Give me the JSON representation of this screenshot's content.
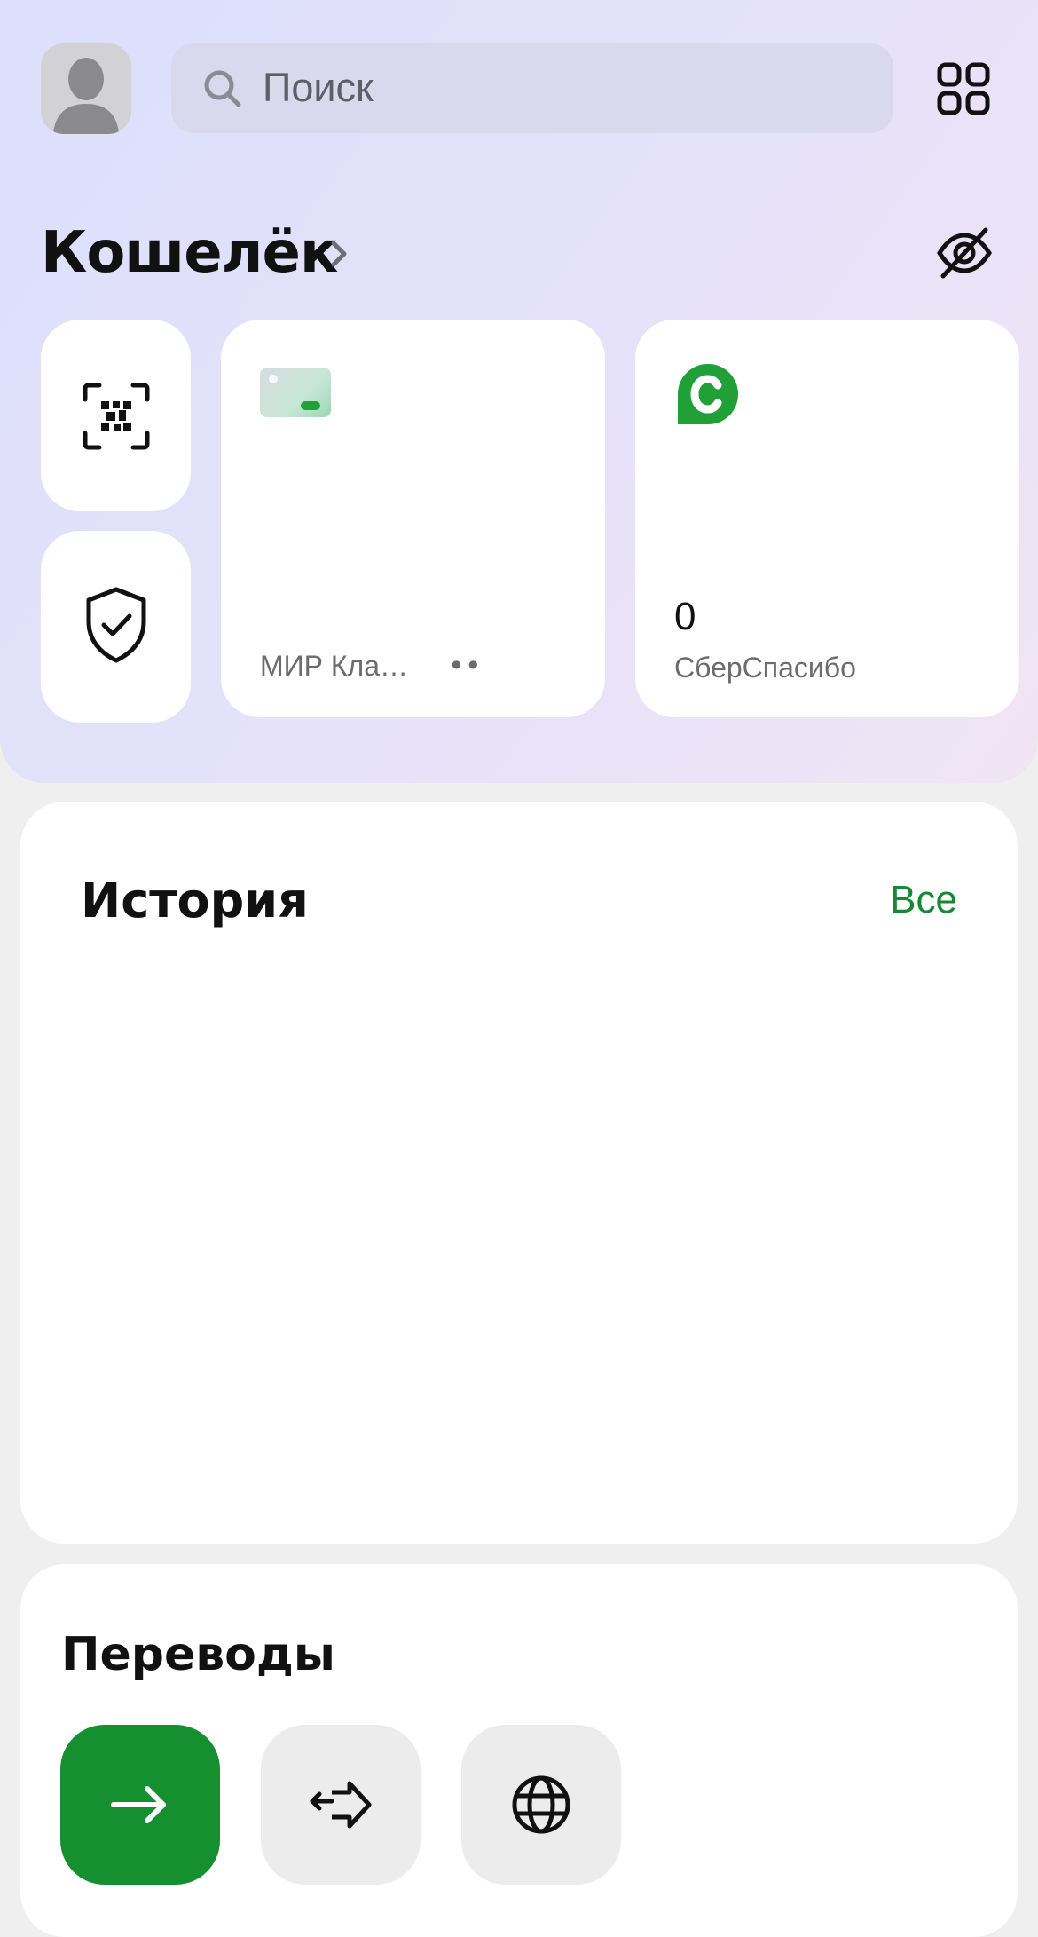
{
  "header": {
    "search_placeholder": "Поиск"
  },
  "wallet": {
    "title": "Кошелёк",
    "card": {
      "name": "МИР Кла…",
      "number_mask": "••"
    },
    "bonus": {
      "balance": "0",
      "label": "СберСпасибо"
    }
  },
  "history": {
    "title": "История",
    "all_label": "Все"
  },
  "transfers": {
    "title": "Переводы",
    "buttons": [
      "arrow-right-icon",
      "transfer-arrows-icon",
      "globe-icon"
    ]
  },
  "colors": {
    "accent_green": "#168f31",
    "link_green": "#168a32"
  }
}
